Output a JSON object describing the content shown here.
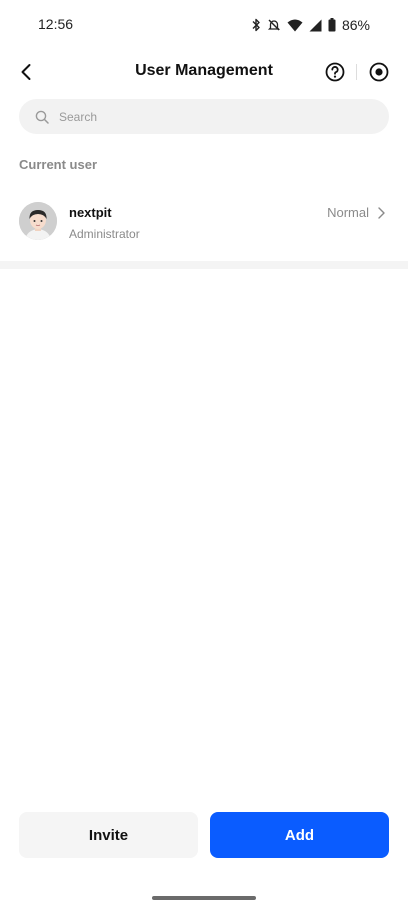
{
  "status_bar": {
    "time": "12:56",
    "battery": "86%",
    "icons": [
      "bluetooth-icon",
      "mute-icon",
      "wifi-icon",
      "signal-icon",
      "battery-icon"
    ]
  },
  "header": {
    "title": "User Management",
    "icons": [
      "back-arrow-icon",
      "help-circle-icon",
      "record-circle-icon"
    ]
  },
  "search": {
    "placeholder": "Search"
  },
  "current_user_section": {
    "label": "Current user",
    "user": {
      "name": "nextpit",
      "role": "Administrator",
      "status": "Normal"
    }
  },
  "actions": {
    "invite_label": "Invite",
    "add_label": "Add"
  },
  "colors": {
    "accent": "#0a5cff",
    "secondary_text": "#8a8a8a",
    "search_bg": "#f2f2f2",
    "invite_bg": "#f5f5f5"
  }
}
